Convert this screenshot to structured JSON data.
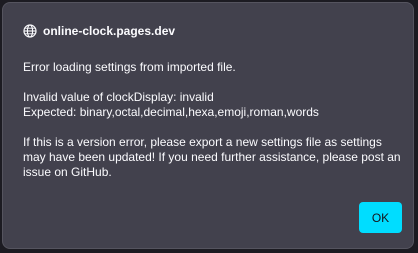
{
  "dialog": {
    "origin": "online-clock.pages.dev",
    "icon": "globe-icon",
    "message_line1": "Error loading settings from imported file.",
    "message_line2": "Invalid value of clockDisplay: invalid",
    "message_line3": "Expected: binary,octal,decimal,hexa,emoji,roman,words",
    "message_line4": "If this is a version error, please export a new settings file as settings may have been updated! If you need further assistance, please post an issue on GitHub.",
    "ok_label": "OK",
    "colors": {
      "background": "#42414d",
      "accent": "#00ddff",
      "text": "#fbfbfe"
    }
  }
}
